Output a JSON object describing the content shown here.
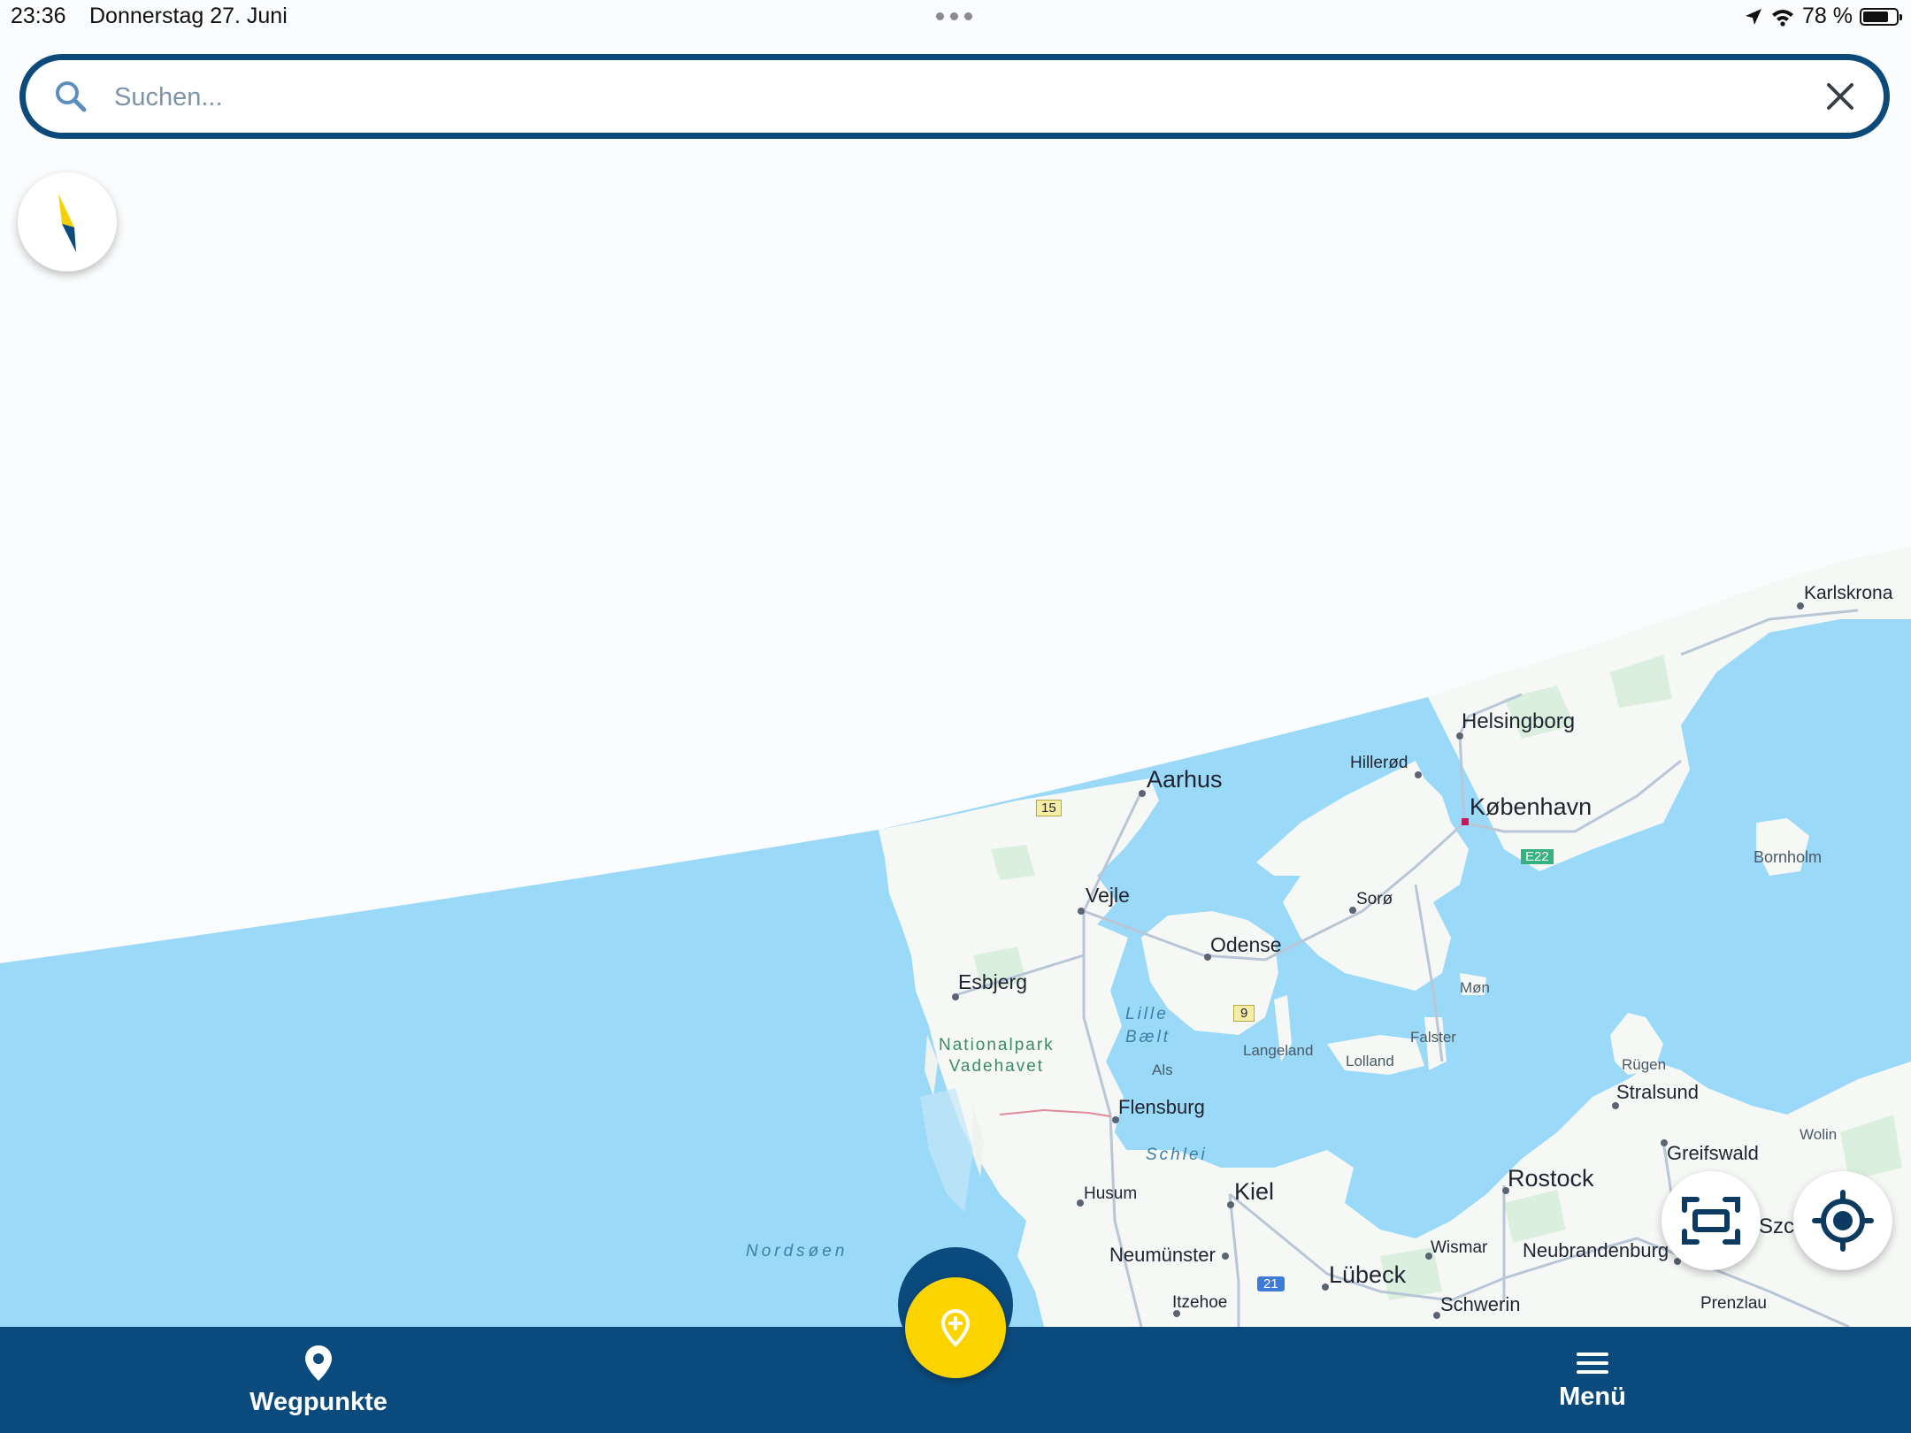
{
  "status_bar": {
    "time": "23:36",
    "date": "Donnerstag 27. Juni",
    "battery": "78 %",
    "battery_level": 0.78,
    "icons": [
      "location-arrow-icon",
      "wifi-icon",
      "battery-icon"
    ]
  },
  "search": {
    "placeholder": "Suchen...",
    "value": ""
  },
  "map": {
    "water_color": "#9bd9f8",
    "land_color": "#f6f8f6",
    "labels": {
      "karlskrona": "Karlskrona",
      "helsingborg": "Helsingborg",
      "aarhus": "Aarhus",
      "hillerod": "Hillerød",
      "kobenhavn": "København",
      "r15": "15",
      "e22": "E22",
      "bornholm": "Bornholm",
      "vejle": "Vejle",
      "soro": "Sorø",
      "odense": "Odense",
      "esbjerg": "Esbjerg",
      "lille_baelt": "Lille\nBælt",
      "r9": "9",
      "mon": "Møn",
      "falster": "Falster",
      "nationalpark": "Nationalpark\nVadehavet",
      "langeland": "Langeland",
      "lolland": "Lolland",
      "als": "Als",
      "rugen": "Rügen",
      "flensburg": "Flensburg",
      "stralsund": "Stralsund",
      "schlei": "Schlei",
      "wolin": "Wolin",
      "greifswald": "Greifswald",
      "husum": "Husum",
      "kiel": "Kiel",
      "rostock": "Rostock",
      "nordsoen": "Nordsøen",
      "szc": "Szc",
      "neumunster": "Neumünster",
      "wismar": "Wismar",
      "neubrandenburg": "Neubrandenburg",
      "luebeck": "Lübeck",
      "a21": "21",
      "itzehoe": "Itzehoe",
      "schwerin": "Schwerin",
      "prenzlau": "Prenzlau"
    }
  },
  "controls": {
    "compass_icon": "compass-icon",
    "fit_icon": "fit-bounds-icon",
    "locate_icon": "my-location-icon"
  },
  "bottom_nav": {
    "waypoints_label": "Wegpunkte",
    "menu_label": "Menü",
    "fab_icon": "add-location-icon",
    "accent": "#fbd400",
    "bar_color": "#0b4a7c"
  }
}
